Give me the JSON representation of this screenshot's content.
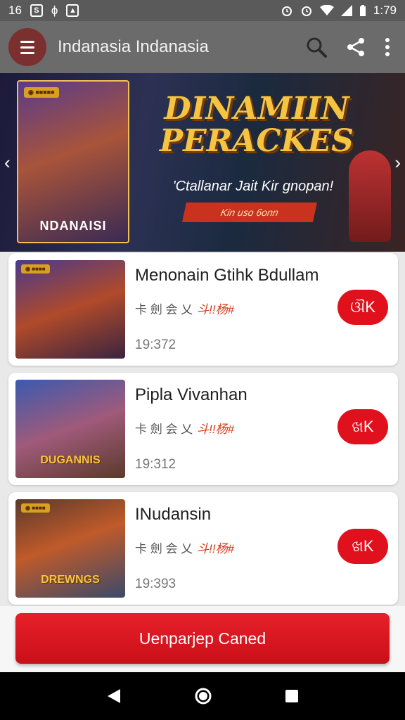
{
  "status_bar": {
    "left_icons": [
      "16",
      "S",
      "ϕ",
      "▲"
    ],
    "time": "1:79"
  },
  "app_bar": {
    "title": "Indanasia Indanasia",
    "icons": [
      "menu-icon",
      "search-icon",
      "share-icon",
      "more-vert-icon"
    ]
  },
  "banner": {
    "poster_tag": "◉ ■■■■■",
    "poster_title": "NDANAISI",
    "headline_line1": "DINAMIIN",
    "headline_line2": "PERACKES",
    "subtitle": "'Ctallanar Jait Kir gnopan!",
    "ribbon": "Kin uso 6onn",
    "arrow_left": "‹",
    "arrow_right": "›"
  },
  "cards": [
    {
      "title": "Menonain Gtihk Bdullam",
      "meta": "卡 劍 会 乂",
      "meta_accent": "斗!!杨#",
      "time": "19:372",
      "button": "ଔK",
      "thumb_tag": "◉ ■■■■",
      "thumb_title": ""
    },
    {
      "title": "Pipla Vivanhan",
      "meta": "卡 劍 会 乂",
      "meta_accent": "斗!!杨#",
      "time": "19:312",
      "button": "ଖK",
      "thumb_tag": "",
      "thumb_title": "DUGANNIS"
    },
    {
      "title": "INudansin",
      "meta": "卡 劍 会 乂",
      "meta_accent": "斗!!杨#",
      "time": "19:393",
      "button": "ଖK",
      "thumb_tag": "◉ ■■■■",
      "thumb_title": "DREWNGS"
    }
  ],
  "cta": {
    "label": "Uenparjep Caned"
  },
  "colors": {
    "accent": "#e0101c",
    "app_bar": "#6b6b6b",
    "menu_button": "#7c2f2f"
  }
}
